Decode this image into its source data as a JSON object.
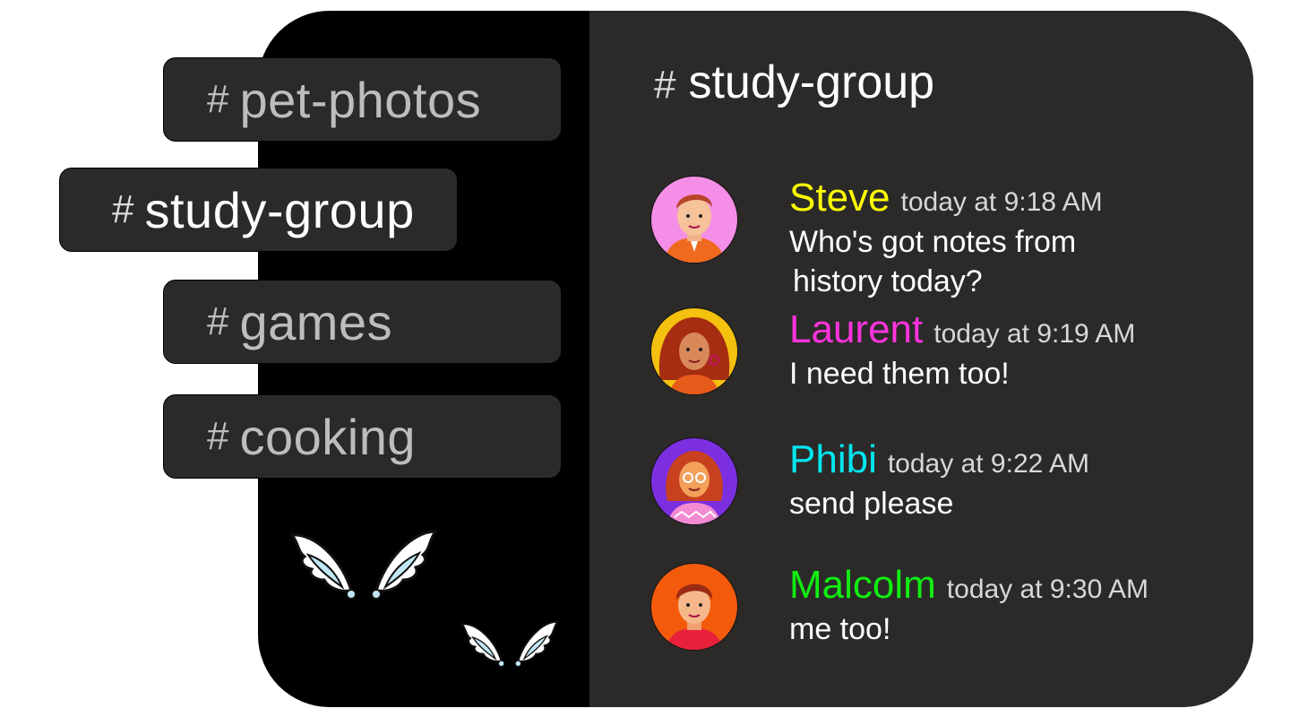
{
  "sidebar": {
    "channels": [
      {
        "hash": "#",
        "name": "pet-photos"
      },
      {
        "hash": "#",
        "name": "study-group"
      },
      {
        "hash": "#",
        "name": "games"
      },
      {
        "hash": "#",
        "name": "cooking"
      }
    ],
    "decoration_icons": [
      "wings-icon",
      "wings-icon"
    ]
  },
  "chat": {
    "header": {
      "hash": "#",
      "name": "study-group"
    },
    "messages": [
      {
        "author": "Steve",
        "author_color": "#ffff00",
        "time": "today at 9:18 AM",
        "lines": [
          "Who's got notes from",
          "history today?"
        ]
      },
      {
        "author": "Laurent",
        "author_color": "#ff33dd",
        "time": "today at 9:19 AM",
        "lines": [
          "I need them too!"
        ]
      },
      {
        "author": "Phibi",
        "author_color": "#00e5ee",
        "time": "today at 9:22 AM",
        "lines": [
          "send please"
        ]
      },
      {
        "author": "Malcolm",
        "author_color": "#11ee11",
        "time": "today at 9:30 AM",
        "lines": [
          "me too!"
        ]
      }
    ]
  },
  "colors": {
    "panel": "#2b2a29",
    "background": "#000000",
    "text": "#ffffff",
    "muted_text": "#bdbdbd"
  }
}
